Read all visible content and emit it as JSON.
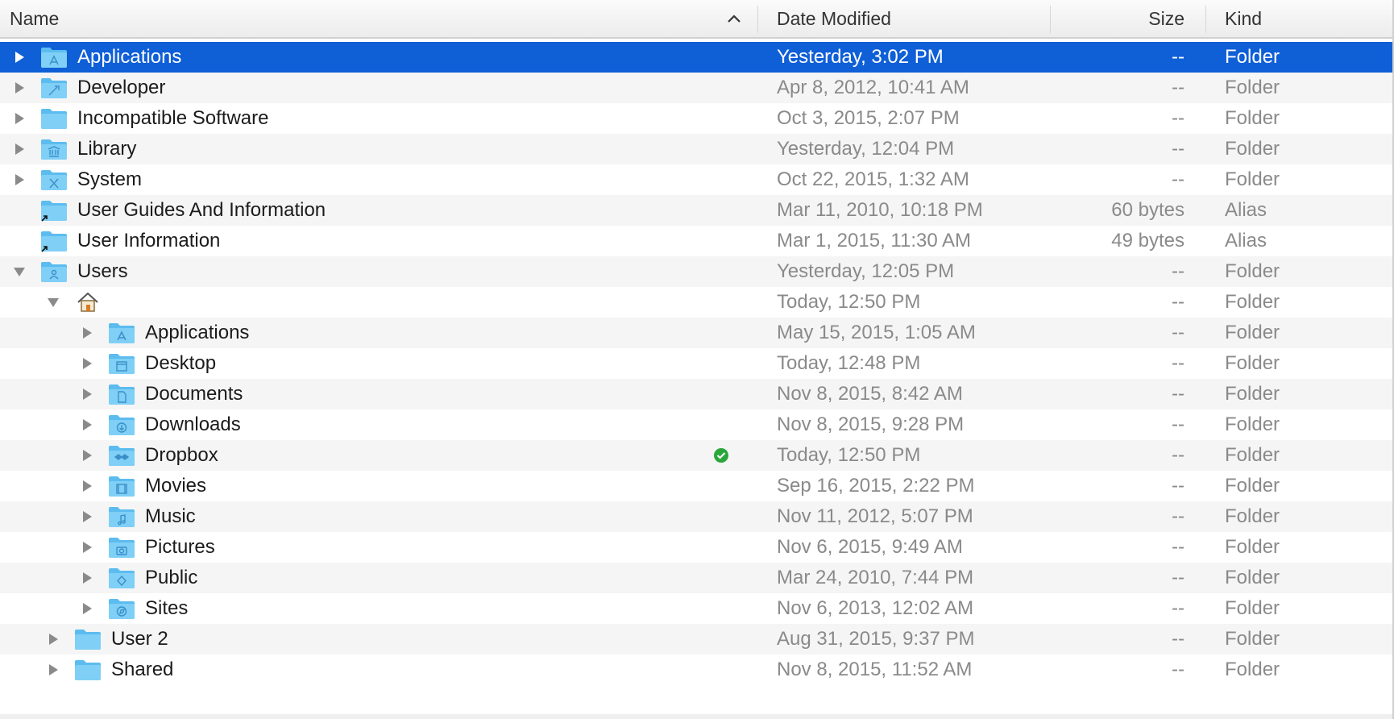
{
  "columns": {
    "name": "Name",
    "date": "Date Modified",
    "size": "Size",
    "kind": "Kind"
  },
  "sort": {
    "column": "Name",
    "direction": "ascending",
    "icon": "chevron-up-icon"
  },
  "colors": {
    "selection": "#0f5fd7",
    "folder": "#6cc6f3",
    "stripe": "#f5f5f5",
    "sync_ok": "#2aa63c"
  },
  "rows": [
    {
      "name": "Applications",
      "date": "Yesterday, 3:02 PM",
      "size": "--",
      "kind": "Folder",
      "level": 0,
      "disclosure": "collapsed",
      "icon": "applications-folder-icon",
      "selected": true
    },
    {
      "name": "Developer",
      "date": "Apr 8, 2012, 10:41 AM",
      "size": "--",
      "kind": "Folder",
      "level": 0,
      "disclosure": "collapsed",
      "icon": "developer-folder-icon"
    },
    {
      "name": "Incompatible Software",
      "date": "Oct 3, 2015, 2:07 PM",
      "size": "--",
      "kind": "Folder",
      "level": 0,
      "disclosure": "collapsed",
      "icon": "folder-icon"
    },
    {
      "name": "Library",
      "date": "Yesterday, 12:04 PM",
      "size": "--",
      "kind": "Folder",
      "level": 0,
      "disclosure": "collapsed",
      "icon": "library-folder-icon"
    },
    {
      "name": "System",
      "date": "Oct 22, 2015, 1:32 AM",
      "size": "--",
      "kind": "Folder",
      "level": 0,
      "disclosure": "collapsed",
      "icon": "system-folder-icon"
    },
    {
      "name": "User Guides And Information",
      "date": "Mar 11, 2010, 10:18 PM",
      "size": "60 bytes",
      "kind": "Alias",
      "level": 0,
      "disclosure": "none",
      "icon": "alias-folder-icon"
    },
    {
      "name": "User Information",
      "date": "Mar 1, 2015, 11:30 AM",
      "size": "49 bytes",
      "kind": "Alias",
      "level": 0,
      "disclosure": "none",
      "icon": "alias-folder-icon"
    },
    {
      "name": "Users",
      "date": "Yesterday, 12:05 PM",
      "size": "--",
      "kind": "Folder",
      "level": 0,
      "disclosure": "expanded",
      "icon": "users-folder-icon"
    },
    {
      "name": "",
      "date": "Today, 12:50 PM",
      "size": "--",
      "kind": "Folder",
      "level": 1,
      "disclosure": "expanded",
      "icon": "home-icon"
    },
    {
      "name": "Applications",
      "date": "May 15, 2015, 1:05 AM",
      "size": "--",
      "kind": "Folder",
      "level": 2,
      "disclosure": "collapsed",
      "icon": "applications-folder-icon"
    },
    {
      "name": "Desktop",
      "date": "Today, 12:48 PM",
      "size": "--",
      "kind": "Folder",
      "level": 2,
      "disclosure": "collapsed",
      "icon": "desktop-folder-icon"
    },
    {
      "name": "Documents",
      "date": "Nov 8, 2015, 8:42 AM",
      "size": "--",
      "kind": "Folder",
      "level": 2,
      "disclosure": "collapsed",
      "icon": "documents-folder-icon"
    },
    {
      "name": "Downloads",
      "date": "Nov 8, 2015, 9:28 PM",
      "size": "--",
      "kind": "Folder",
      "level": 2,
      "disclosure": "collapsed",
      "icon": "downloads-folder-icon"
    },
    {
      "name": "Dropbox",
      "date": "Today, 12:50 PM",
      "size": "--",
      "kind": "Folder",
      "level": 2,
      "disclosure": "collapsed",
      "icon": "dropbox-folder-icon",
      "badge": "sync-checkmark-icon"
    },
    {
      "name": "Movies",
      "date": "Sep 16, 2015, 2:22 PM",
      "size": "--",
      "kind": "Folder",
      "level": 2,
      "disclosure": "collapsed",
      "icon": "movies-folder-icon"
    },
    {
      "name": "Music",
      "date": "Nov 11, 2012, 5:07 PM",
      "size": "--",
      "kind": "Folder",
      "level": 2,
      "disclosure": "collapsed",
      "icon": "music-folder-icon"
    },
    {
      "name": "Pictures",
      "date": "Nov 6, 2015, 9:49 AM",
      "size": "--",
      "kind": "Folder",
      "level": 2,
      "disclosure": "collapsed",
      "icon": "pictures-folder-icon"
    },
    {
      "name": "Public",
      "date": "Mar 24, 2010, 7:44 PM",
      "size": "--",
      "kind": "Folder",
      "level": 2,
      "disclosure": "collapsed",
      "icon": "public-folder-icon"
    },
    {
      "name": "Sites",
      "date": "Nov 6, 2013, 12:02 AM",
      "size": "--",
      "kind": "Folder",
      "level": 2,
      "disclosure": "collapsed",
      "icon": "sites-folder-icon"
    },
    {
      "name": "User 2",
      "date": "Aug 31, 2015, 9:37 PM",
      "size": "--",
      "kind": "Folder",
      "level": 1,
      "disclosure": "collapsed",
      "icon": "folder-icon"
    },
    {
      "name": "Shared",
      "date": "Nov 8, 2015, 11:52 AM",
      "size": "--",
      "kind": "Folder",
      "level": 1,
      "disclosure": "collapsed",
      "icon": "folder-icon"
    }
  ]
}
